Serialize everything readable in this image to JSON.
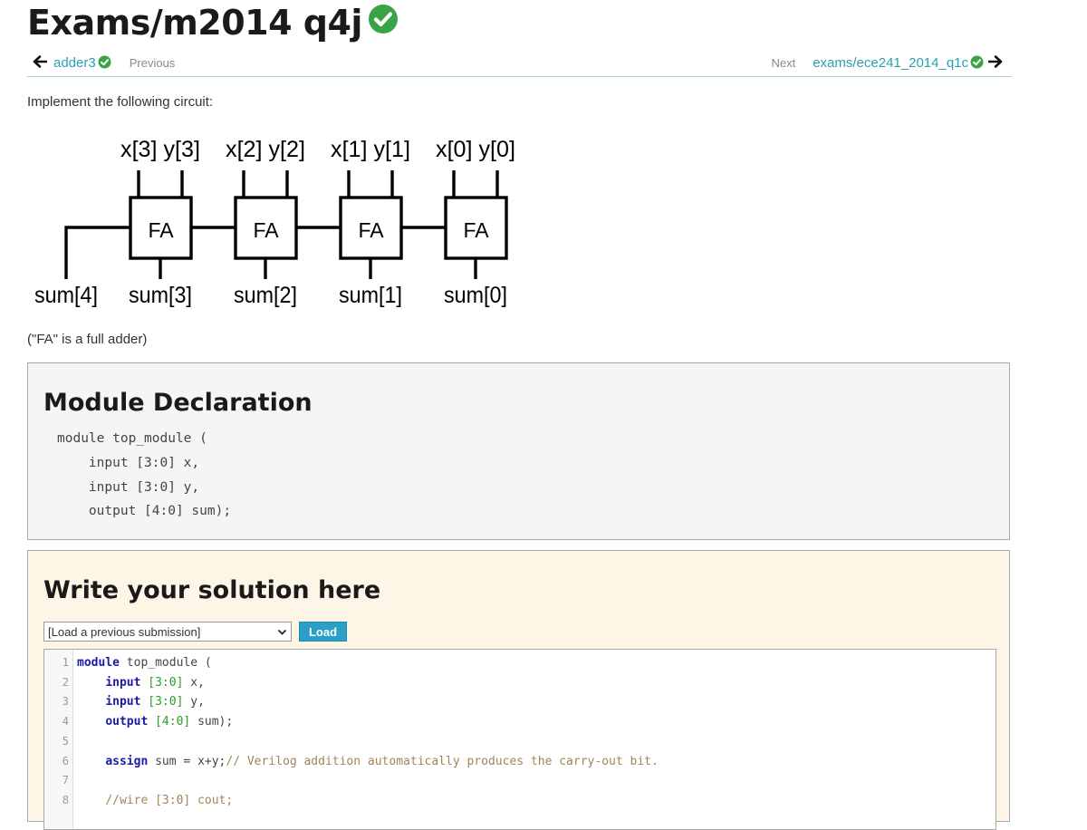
{
  "page": {
    "title": "Exams/m2014 q4j"
  },
  "nav": {
    "prev_link": "adder3",
    "prev_label": "Previous",
    "next_label": "Next",
    "next_link": "exams/ece241_2014_q1c"
  },
  "intro": "Implement the following circuit:",
  "circuit": {
    "inputs": [
      "x[3] y[3]",
      "x[2] y[2]",
      "x[1] y[1]",
      "x[0] y[0]"
    ],
    "block_label": "FA",
    "outputs": [
      "sum[4]",
      "sum[3]",
      "sum[2]",
      "sum[1]",
      "sum[0]"
    ]
  },
  "fa_note": "(\"FA\" is a full adder)",
  "module_declaration": {
    "heading": "Module Declaration",
    "code": "module top_module (\n    input [3:0] x,\n    input [3:0] y,\n    output [4:0] sum);"
  },
  "solution": {
    "heading": "Write your solution here",
    "select_value": "[Load a previous submission]",
    "load_label": "Load",
    "lines": [
      {
        "n": "1",
        "kw": "module",
        "rest": " top_module ("
      },
      {
        "n": "2",
        "indent": "    ",
        "kw": "input",
        "num": "[3:0]",
        "rest": " x,"
      },
      {
        "n": "3",
        "indent": "    ",
        "kw": "input",
        "num": "[3:0]",
        "rest": " y,"
      },
      {
        "n": "4",
        "indent": "    ",
        "kw": "output",
        "num": "[4:0]",
        "rest": " sum);"
      },
      {
        "n": "5"
      },
      {
        "n": "6",
        "indent": "    ",
        "kw": "assign",
        "rest": " sum = x+y;",
        "comment": "// Verilog addition automatically produces the carry-out bit."
      },
      {
        "n": "7"
      },
      {
        "n": "8",
        "indent": "    ",
        "comment": "//wire [3:0] cout;"
      }
    ]
  }
}
